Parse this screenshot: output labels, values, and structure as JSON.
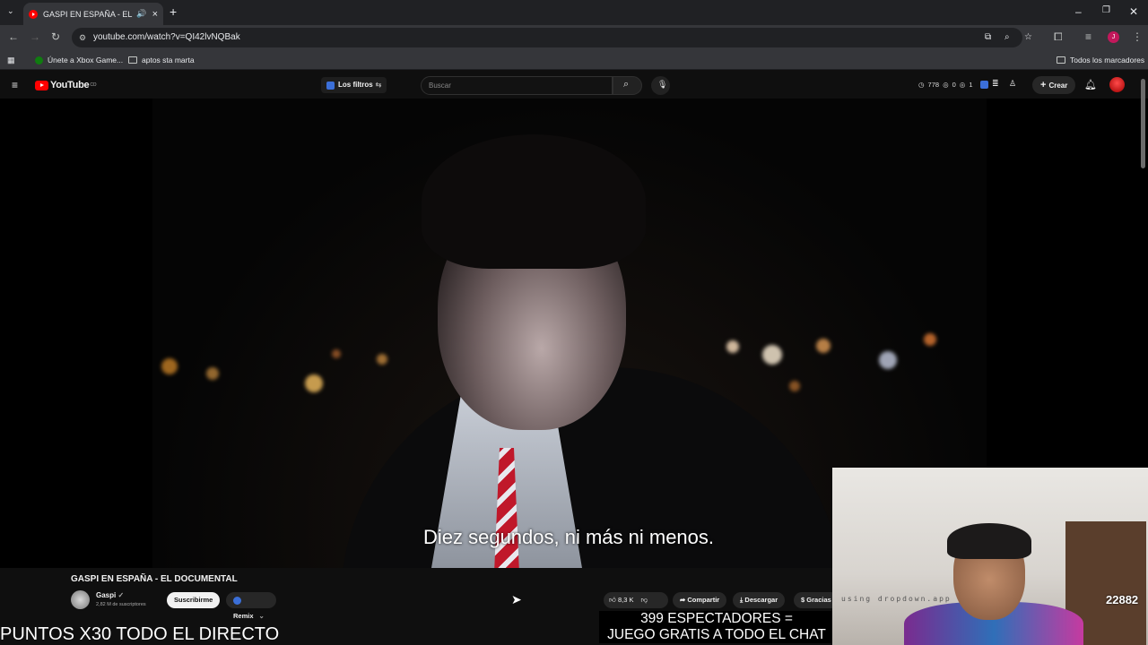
{
  "browser": {
    "tab_title": "GASPI EN ESPAÑA - EL DOCUMENTAL",
    "url": "youtube.com/watch?v=QI42lvNQBak",
    "bookmarks": [
      "Únete a Xbox Game...",
      "aptos sta marta"
    ],
    "all_bookmarks": "Todos los marcadores",
    "profile_initial": "J"
  },
  "youtube": {
    "logo_text": "YouTube",
    "logo_country": "CO",
    "filter_label": "Los filtros",
    "search_placeholder": "Buscar",
    "stats": {
      "views": "778",
      "b": "0",
      "c": "1"
    },
    "create_label": "Crear"
  },
  "video": {
    "subtitle": "Diez segundos, ni más ni menos.",
    "title": "GASPI EN ESPAÑA - EL DOCUMENTAL",
    "channel": "Gaspi",
    "subscribers": "2,82 M de suscriptores",
    "subscribe_label": "Suscribirme",
    "remix_label": "Remix",
    "likes": "8,3 K",
    "share_label": "Compartir",
    "download_label": "Descargar",
    "thanks_label": "Gracias"
  },
  "stream_overlay": {
    "left_text": "PUNTOS X30 TODO EL DIRECTO",
    "right_line1": "399 ESPECTADORES =",
    "right_line2": "JUEGO GRATIS A TODO EL CHAT",
    "cam_caption": "using dropdown.app",
    "cam_badge": "22882"
  },
  "colors": {
    "yt_red": "#ff0000",
    "bg": "#0f0f0f",
    "chrome": "#35363a"
  }
}
